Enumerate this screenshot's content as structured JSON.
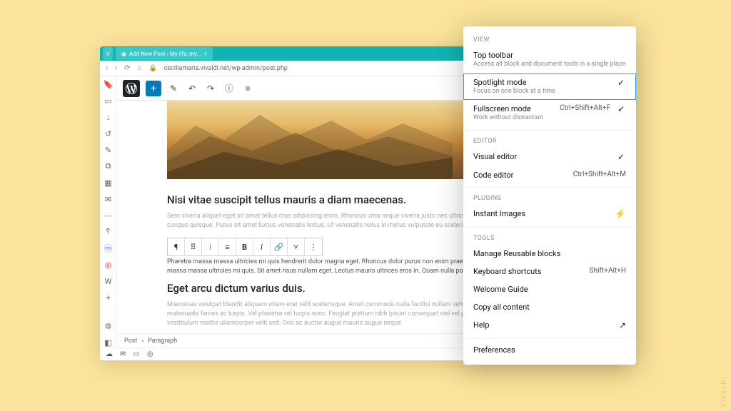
{
  "browser": {
    "tab_title": "Add New Post ‹ My life, my...",
    "url": "ceciliamaria.vivaldi.net/wp-admin/post.php"
  },
  "post": {
    "heading1": "Nisi vitae suscipit tellus mauris a diam maecenas.",
    "para1": "Sem viverra aliquet eget sit amet tellus cras adipiscing enim. Rhoncus urna neque viverra justo nec ultrices dui. Eu mi bibendum neque egestas congue quisque. Purus sit amet luctus venenatis lectus. Ut venenatis tellus in metus vulputate eu scelerisque in dictum non.",
    "para2": "Pharetra massa massa ultricies mi quis hendrerit dolor magna eget. Rhoncus dolor purus non enim praesent elementum. Pharetra pharetra massa massa ultricies mi quis. Sit amet risus nullam eget. Lectus mauris ultrices eros in. Quam nulla porttitor massa id neque aliquam.",
    "heading2": "Eget arcu dictum varius duis.",
    "para3": "Maecenas volutpat blandit aliquam etiam erat velit scelerisque. Amet commodo nulla facilisi nullam vehicula ipsum a. Senectus et netus et malesuada fames ac turpis. Vel pharetra vel turpis nunc. Feugiat pretium nibh ipsum consequat nisl vel pretium lectus. Ac feugiat sed lectus vestibulum mattis ullamcorper velit sed. Orci ac auctor augue mauris augue neque"
  },
  "breadcrumb": {
    "a": "Post",
    "b": "Paragraph"
  },
  "menu": {
    "sect_view": "VIEW",
    "top_toolbar": {
      "title": "Top toolbar",
      "desc": "Access all block and document tools in a single place"
    },
    "spotlight": {
      "title": "Spotlight mode",
      "desc": "Focus on one block at a time"
    },
    "fullscreen": {
      "title": "Fullscreen mode",
      "desc": "Work without distraction",
      "kbd": "Ctrl+Shift+Alt+F"
    },
    "sect_editor": "EDITOR",
    "visual": "Visual editor",
    "code": {
      "title": "Code editor",
      "kbd": "Ctrl+Shift+Alt+M"
    },
    "sect_plugins": "PLUGINS",
    "instant": "Instant Images",
    "sect_tools": "TOOLS",
    "reusable": "Manage Reusable blocks",
    "shortcuts": {
      "title": "Keyboard shortcuts",
      "kbd": "Shift+Alt+H"
    },
    "welcome": "Welcome Guide",
    "copyall": "Copy all content",
    "help": "Help",
    "prefs": "Preferences"
  },
  "watermark": "VIVALDI"
}
